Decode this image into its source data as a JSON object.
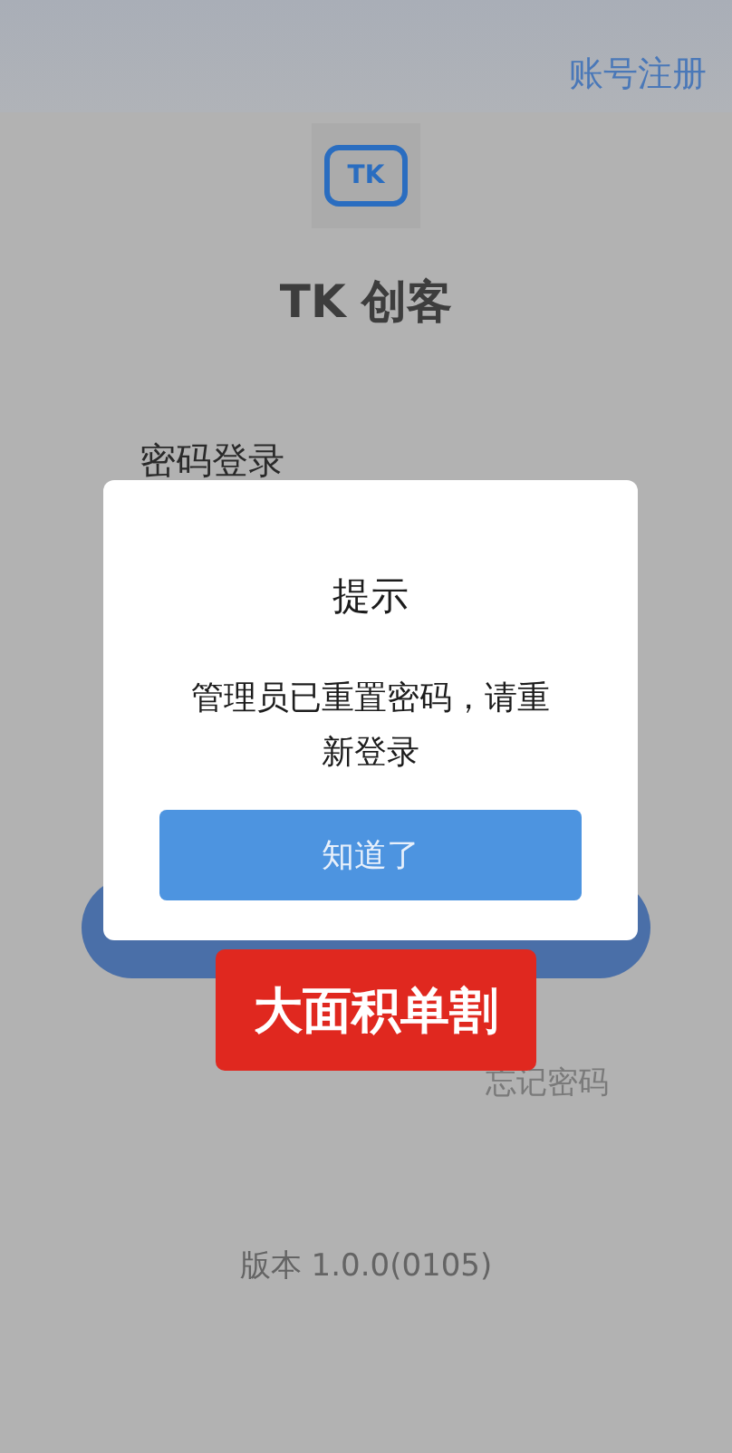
{
  "header": {
    "register_link": "账号注册"
  },
  "logo": {
    "mark": "TK"
  },
  "app_title": "TK 创客",
  "login_tab": "密码登录",
  "forgot_password": "忘记密码",
  "version": "版本 1.0.0(0105)",
  "dialog": {
    "title": "提示",
    "message": "管理员已重置密码，请重新登录",
    "button": "知道了"
  },
  "overlay_label": "大面积单割"
}
